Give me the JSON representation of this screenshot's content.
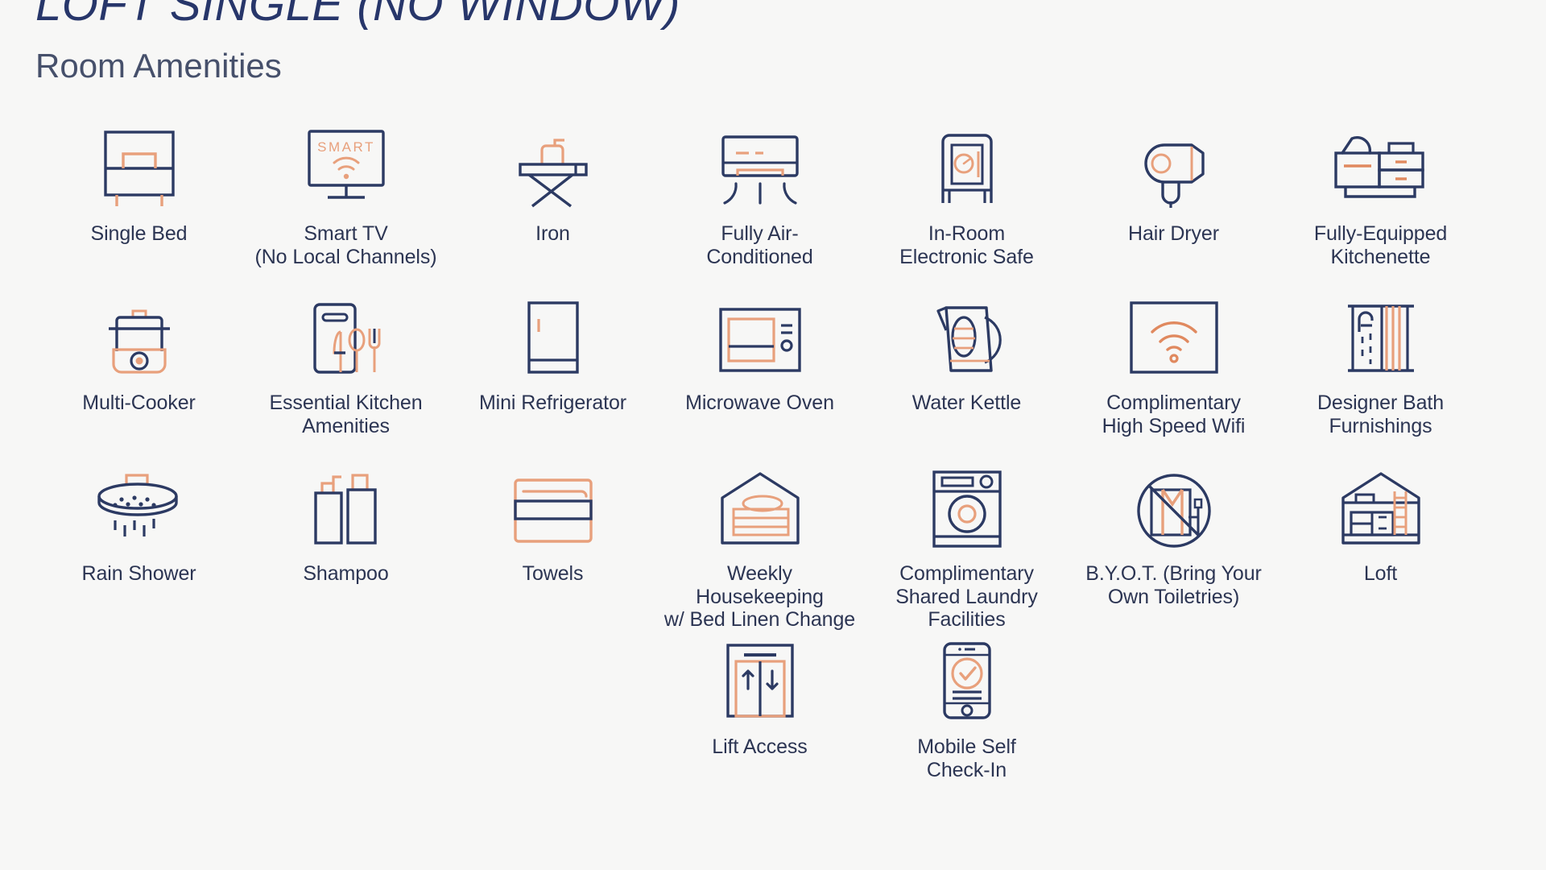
{
  "header": {
    "room_title": "LOFT SINGLE (NO WINDOW)",
    "section_title": "Room Amenities"
  },
  "colors": {
    "background": "#f7f7f6",
    "navy": "#2c3a63",
    "navy_text": "#2c3553",
    "title_navy": "#27366a",
    "orange": "#e8a07c",
    "orange_dark": "#e0895f"
  },
  "amenities": {
    "rows": [
      [
        {
          "label": "Single Bed",
          "icon": "single-bed-icon"
        },
        {
          "label": "Smart TV\n(No Local Channels)",
          "icon": "smart-tv-icon"
        },
        {
          "label": "Iron",
          "icon": "iron-icon"
        },
        {
          "label": "Fully Air-\nConditioned",
          "icon": "air-conditioner-icon"
        },
        {
          "label": "In-Room\nElectronic Safe",
          "icon": "safe-icon"
        },
        {
          "label": "Hair Dryer",
          "icon": "hair-dryer-icon"
        },
        {
          "label": "Fully-Equipped\nKitchenette",
          "icon": "kitchenette-icon"
        }
      ],
      [
        {
          "label": "Multi-Cooker",
          "icon": "multi-cooker-icon"
        },
        {
          "label": "Essential Kitchen\nAmenities",
          "icon": "kitchen-utensils-icon"
        },
        {
          "label": "Mini Refrigerator",
          "icon": "refrigerator-icon"
        },
        {
          "label": "Microwave Oven",
          "icon": "microwave-icon"
        },
        {
          "label": "Water Kettle",
          "icon": "kettle-icon"
        },
        {
          "label": "Complimentary\nHigh Speed Wifi",
          "icon": "wifi-icon"
        },
        {
          "label": "Designer Bath\nFurnishings",
          "icon": "bath-shower-icon"
        }
      ],
      [
        {
          "label": "Rain Shower",
          "icon": "rain-shower-icon"
        },
        {
          "label": "Shampoo",
          "icon": "shampoo-icon"
        },
        {
          "label": "Towels",
          "icon": "towels-icon"
        },
        {
          "label": "Weekly Housekeeping\nw/ Bed Linen Change",
          "icon": "housekeeping-icon"
        },
        {
          "label": "Complimentary\nShared Laundry\nFacilities",
          "icon": "laundry-icon"
        },
        {
          "label": "B.Y.O.T. (Bring Your\nOwn Toiletries)",
          "icon": "no-toiletries-icon"
        },
        {
          "label": "Loft",
          "icon": "loft-icon"
        }
      ],
      [
        {
          "label": "Lift Access",
          "icon": "lift-icon"
        },
        {
          "label": "Mobile Self\nCheck-In",
          "icon": "mobile-checkin-icon"
        }
      ]
    ]
  },
  "icon_text": {
    "smart_tv_screen": "SMART"
  }
}
